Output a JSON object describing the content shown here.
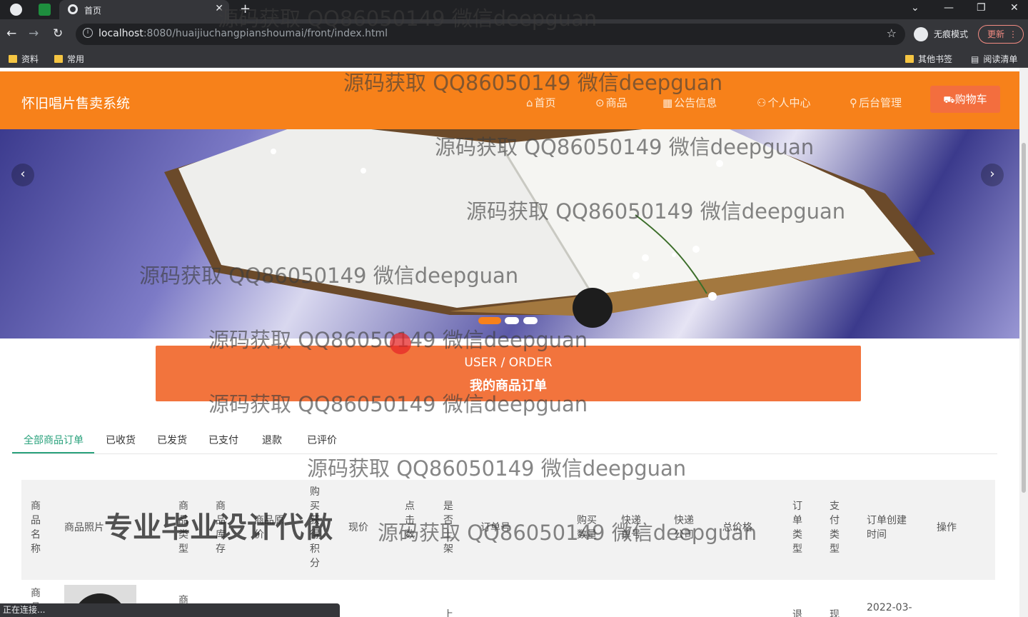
{
  "browser": {
    "tab_title": "首页",
    "url_host": "localhost",
    "url_rest": ":8080/huaijiuchangpianshoumai/front/index.html",
    "incognito_label": "无痕模式",
    "update_label": "更新",
    "bookmarks": [
      "资料",
      "常用"
    ],
    "bookmarks_right": [
      "其他书签",
      "阅读清单"
    ],
    "status_text": "正在连接..."
  },
  "site": {
    "brand": "怀旧唱片售卖系统",
    "nav": [
      {
        "icon": "⌂",
        "label": "首页"
      },
      {
        "icon": "⊙",
        "label": "商品"
      },
      {
        "icon": "▦",
        "label": "公告信息"
      },
      {
        "icon": "⚇",
        "label": "个人中心"
      },
      {
        "icon": "⚲",
        "label": "后台管理"
      }
    ],
    "cart": {
      "icon": "🛒",
      "label": "购物车"
    }
  },
  "order_header": {
    "en": "USER / ORDER",
    "cn": "我的商品订单"
  },
  "order_tabs": [
    "全部商品订单",
    "已收货",
    "已发货",
    "已支付",
    "退款",
    "已评价"
  ],
  "table": {
    "headers": [
      "商品名称",
      "商品照片",
      "商品类型",
      "商品库存",
      "商品原价",
      "购买获得积分",
      "现价",
      "点击数",
      "是否上架",
      "订单号",
      "购买数量",
      "快递单号",
      "快递公司",
      "总价格",
      "订单类型",
      "支付类型",
      "订单创建时间",
      "操作"
    ],
    "row": {
      "name": "商品",
      "type": "商品",
      "onsale": "上",
      "order_type": "退",
      "pay_type": "现",
      "created": "2022-03-"
    }
  },
  "watermarks": {
    "text": "源码获取 QQ86050149 微信deepguan",
    "big": "专业毕业设计代做"
  }
}
